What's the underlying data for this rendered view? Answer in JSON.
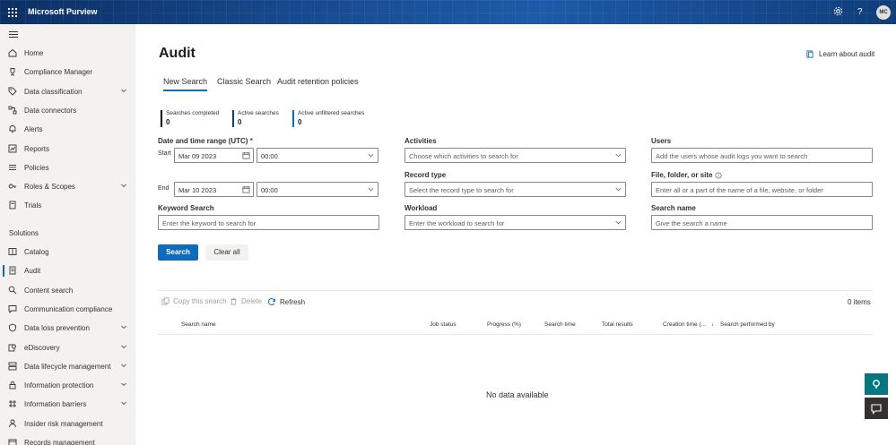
{
  "app": {
    "title": "Microsoft Purview",
    "avatar_initials": "MC",
    "accent": "#0f6cbd",
    "topbar_color": "#0f3d7a"
  },
  "topbar_icons": [
    "waffle-icon",
    "gear-icon",
    "help-icon"
  ],
  "sidebar": {
    "items": [
      {
        "label": "Home",
        "icon": "home-icon",
        "has_chevron": false
      },
      {
        "label": "Compliance Manager",
        "icon": "trophy-icon",
        "has_chevron": false
      },
      {
        "label": "Data classification",
        "icon": "tag-icon",
        "has_chevron": true
      },
      {
        "label": "Data connectors",
        "icon": "connector-icon",
        "has_chevron": false
      },
      {
        "label": "Alerts",
        "icon": "bell-icon",
        "has_chevron": false
      },
      {
        "label": "Reports",
        "icon": "chart-icon",
        "has_chevron": false
      },
      {
        "label": "Policies",
        "icon": "policies-icon",
        "has_chevron": false
      },
      {
        "label": "Roles & Scopes",
        "icon": "key-icon",
        "has_chevron": true
      },
      {
        "label": "Trials",
        "icon": "trials-icon",
        "has_chevron": false
      }
    ],
    "section_label": "Solutions",
    "solutions": [
      {
        "label": "Catalog",
        "icon": "catalog-icon",
        "has_chevron": false
      },
      {
        "label": "Audit",
        "icon": "audit-icon",
        "has_chevron": false,
        "active": true
      },
      {
        "label": "Content search",
        "icon": "search-icon",
        "has_chevron": false
      },
      {
        "label": "Communication compliance",
        "icon": "chat-icon",
        "has_chevron": false
      },
      {
        "label": "Data loss prevention",
        "icon": "shield-icon",
        "has_chevron": true
      },
      {
        "label": "eDiscovery",
        "icon": "ediscovery-icon",
        "has_chevron": true
      },
      {
        "label": "Data lifecycle management",
        "icon": "lifecycle-icon",
        "has_chevron": true
      },
      {
        "label": "Information protection",
        "icon": "lock-icon",
        "has_chevron": true
      },
      {
        "label": "Information barriers",
        "icon": "barrier-icon",
        "has_chevron": true
      },
      {
        "label": "Insider risk management",
        "icon": "person-icon",
        "has_chevron": false
      },
      {
        "label": "Records management",
        "icon": "records-icon",
        "has_chevron": false
      }
    ]
  },
  "page": {
    "title": "Audit",
    "learn_link": "Learn about audit",
    "tabs": [
      "New Search",
      "Classic Search",
      "Audit retention policies"
    ],
    "active_tab": 0
  },
  "stats": [
    {
      "label": "Searches completed",
      "value": "0",
      "color": "#000000"
    },
    {
      "label": "Active searches",
      "value": "0",
      "color": "#0f3d7a"
    },
    {
      "label": "Active unfiltered searches",
      "value": "0",
      "color": "#0f6cbd"
    }
  ],
  "form": {
    "date_range_label": "Date and time range (UTC)",
    "required_mark": "*",
    "start_label": "Start",
    "end_label": "End",
    "start_date": "Mar 09 2023",
    "start_time": "00:00",
    "end_date": "Mar 10 2023",
    "end_time": "00:00",
    "keyword_label": "Keyword Search",
    "keyword_placeholder": "Enter the keyword to search for",
    "activities_label": "Activities",
    "activities_placeholder": "Choose which activities to search for",
    "record_type_label": "Record type",
    "record_type_placeholder": "Select the record type to search for",
    "workload_label": "Workload",
    "workload_placeholder": "Enter the workload to search for",
    "users_label": "Users",
    "users_placeholder": "Add the users whose audit logs you want to search",
    "file_label": "File, folder, or site",
    "file_placeholder": "Enter all or a part of the name of a file, website, or folder",
    "search_name_label": "Search name",
    "search_name_placeholder": "Give the search a name",
    "search_button": "Search",
    "clear_button": "Clear all"
  },
  "commands": {
    "copy": "Copy this search",
    "delete": "Delete",
    "refresh": "Refresh",
    "items_count": "0 items"
  },
  "table": {
    "columns": [
      "Search name",
      "Job status",
      "Progress (%)",
      "Search time",
      "Total results",
      "Creation time (...",
      "Search performed by"
    ],
    "empty_text": "No data available"
  }
}
